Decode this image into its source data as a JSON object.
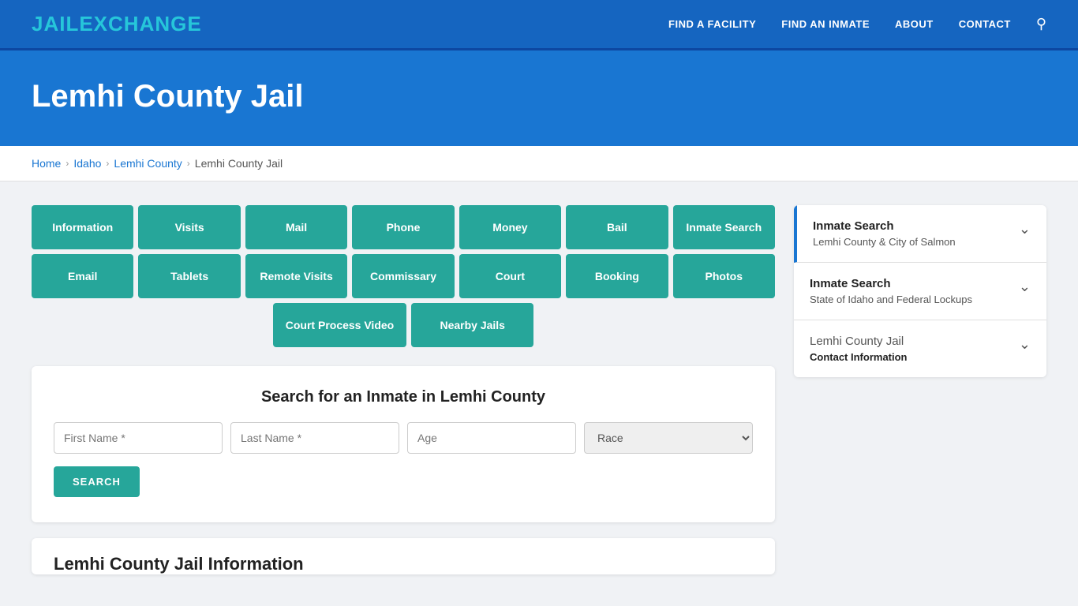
{
  "nav": {
    "logo_jail": "JAIL",
    "logo_exchange": "EXCHANGE",
    "links": [
      {
        "label": "FIND A FACILITY",
        "name": "find-facility-link"
      },
      {
        "label": "FIND AN INMATE",
        "name": "find-inmate-link"
      },
      {
        "label": "ABOUT",
        "name": "about-link"
      },
      {
        "label": "CONTACT",
        "name": "contact-link"
      }
    ]
  },
  "hero": {
    "title": "Lemhi County Jail"
  },
  "breadcrumb": {
    "items": [
      "Home",
      "Idaho",
      "Lemhi County",
      "Lemhi County Jail"
    ]
  },
  "buttons_row1": [
    "Information",
    "Visits",
    "Mail",
    "Phone",
    "Money",
    "Bail",
    "Inmate Search"
  ],
  "buttons_row2": [
    "Email",
    "Tablets",
    "Remote Visits",
    "Commissary",
    "Court",
    "Booking",
    "Photos"
  ],
  "buttons_row3": [
    "Court Process Video",
    "Nearby Jails"
  ],
  "search": {
    "title": "Search for an Inmate in Lemhi County",
    "first_name_placeholder": "First Name *",
    "last_name_placeholder": "Last Name *",
    "age_placeholder": "Age",
    "race_placeholder": "Race",
    "button_label": "SEARCH"
  },
  "section_heading": "Lemhi County Jail Information",
  "sidebar": {
    "items": [
      {
        "title": "Inmate Search",
        "subtitle": "Lemhi County & City of Salmon",
        "active": true
      },
      {
        "title": "Inmate Search",
        "subtitle": "State of Idaho and Federal Lockups",
        "active": false
      },
      {
        "title": "Lemhi County Jail",
        "subtitle": "Contact Information",
        "active": false
      }
    ]
  }
}
